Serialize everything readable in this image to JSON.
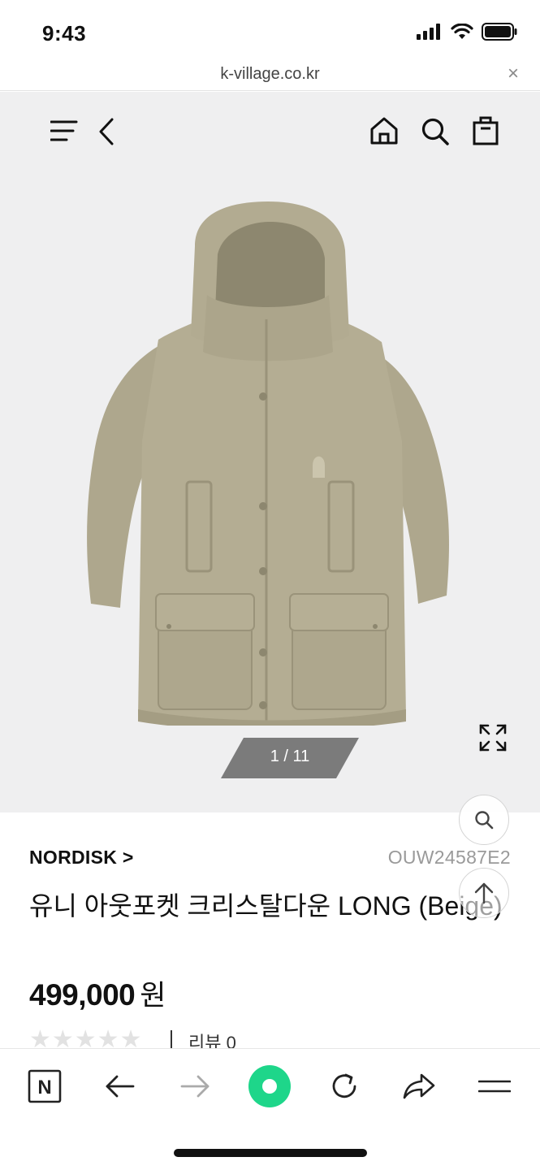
{
  "status_bar": {
    "time": "9:43"
  },
  "browser": {
    "url": "k-village.co.kr",
    "close_symbol": "×"
  },
  "header_nav": {
    "icons": [
      "menu-icon",
      "back-chevron-icon",
      "home-icon",
      "search-icon",
      "shopping-bag-icon"
    ]
  },
  "gallery": {
    "counter": "1 / 11",
    "expand_icon": "expand-arrows-icon"
  },
  "product": {
    "brand": "NORDISK >",
    "sku": "OUW24587E2",
    "title": "유니 아웃포켓 크리스탈다운 LONG (Beige)",
    "price": "499,000",
    "currency": "원",
    "stars": "★★★★★",
    "review_label": "리뷰 0"
  },
  "floating": {
    "icons": [
      "search-icon",
      "scroll-top-arrow-icon"
    ]
  },
  "toolbar": {
    "icons": [
      "naver-n-icon",
      "back-arrow-icon",
      "forward-arrow-icon",
      "green-dot-icon",
      "reload-icon",
      "share-icon",
      "menu-lines-icon"
    ],
    "naver_letter": "N"
  },
  "colors": {
    "jacket": "#b4ad93",
    "image_bg": "#efeff0",
    "counter_bg": "#7b7b7b",
    "green": "#1ed68a"
  }
}
